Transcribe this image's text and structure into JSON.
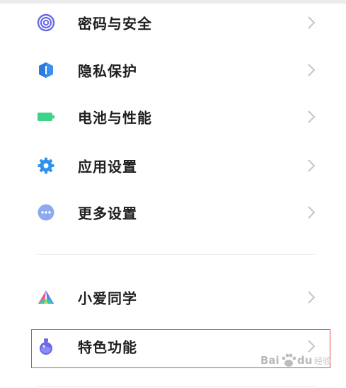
{
  "settings": {
    "items": [
      {
        "label": "密码与安全",
        "icon": "fingerprint-icon",
        "color": "#6a6ae8"
      },
      {
        "label": "隐私保护",
        "icon": "shield-icon",
        "color": "#3a8ff0"
      },
      {
        "label": "电池与性能",
        "icon": "battery-icon",
        "color": "#3fd38a"
      },
      {
        "label": "应用设置",
        "icon": "gear-icon",
        "color": "#2f93ea"
      },
      {
        "label": "更多设置",
        "icon": "more-dots-icon",
        "color": "#8da9f0"
      },
      {
        "label": "小爱同学",
        "icon": "xiaoai-icon",
        "color": "#5a7df2"
      },
      {
        "label": "特色功能",
        "icon": "potion-icon",
        "color": "#6a6ae8"
      }
    ]
  },
  "annotation": {
    "highlight_color": "#e04a4a"
  },
  "watermark": {
    "brand": "Bai",
    "brand_tail": "du",
    "subtitle": "经验"
  }
}
